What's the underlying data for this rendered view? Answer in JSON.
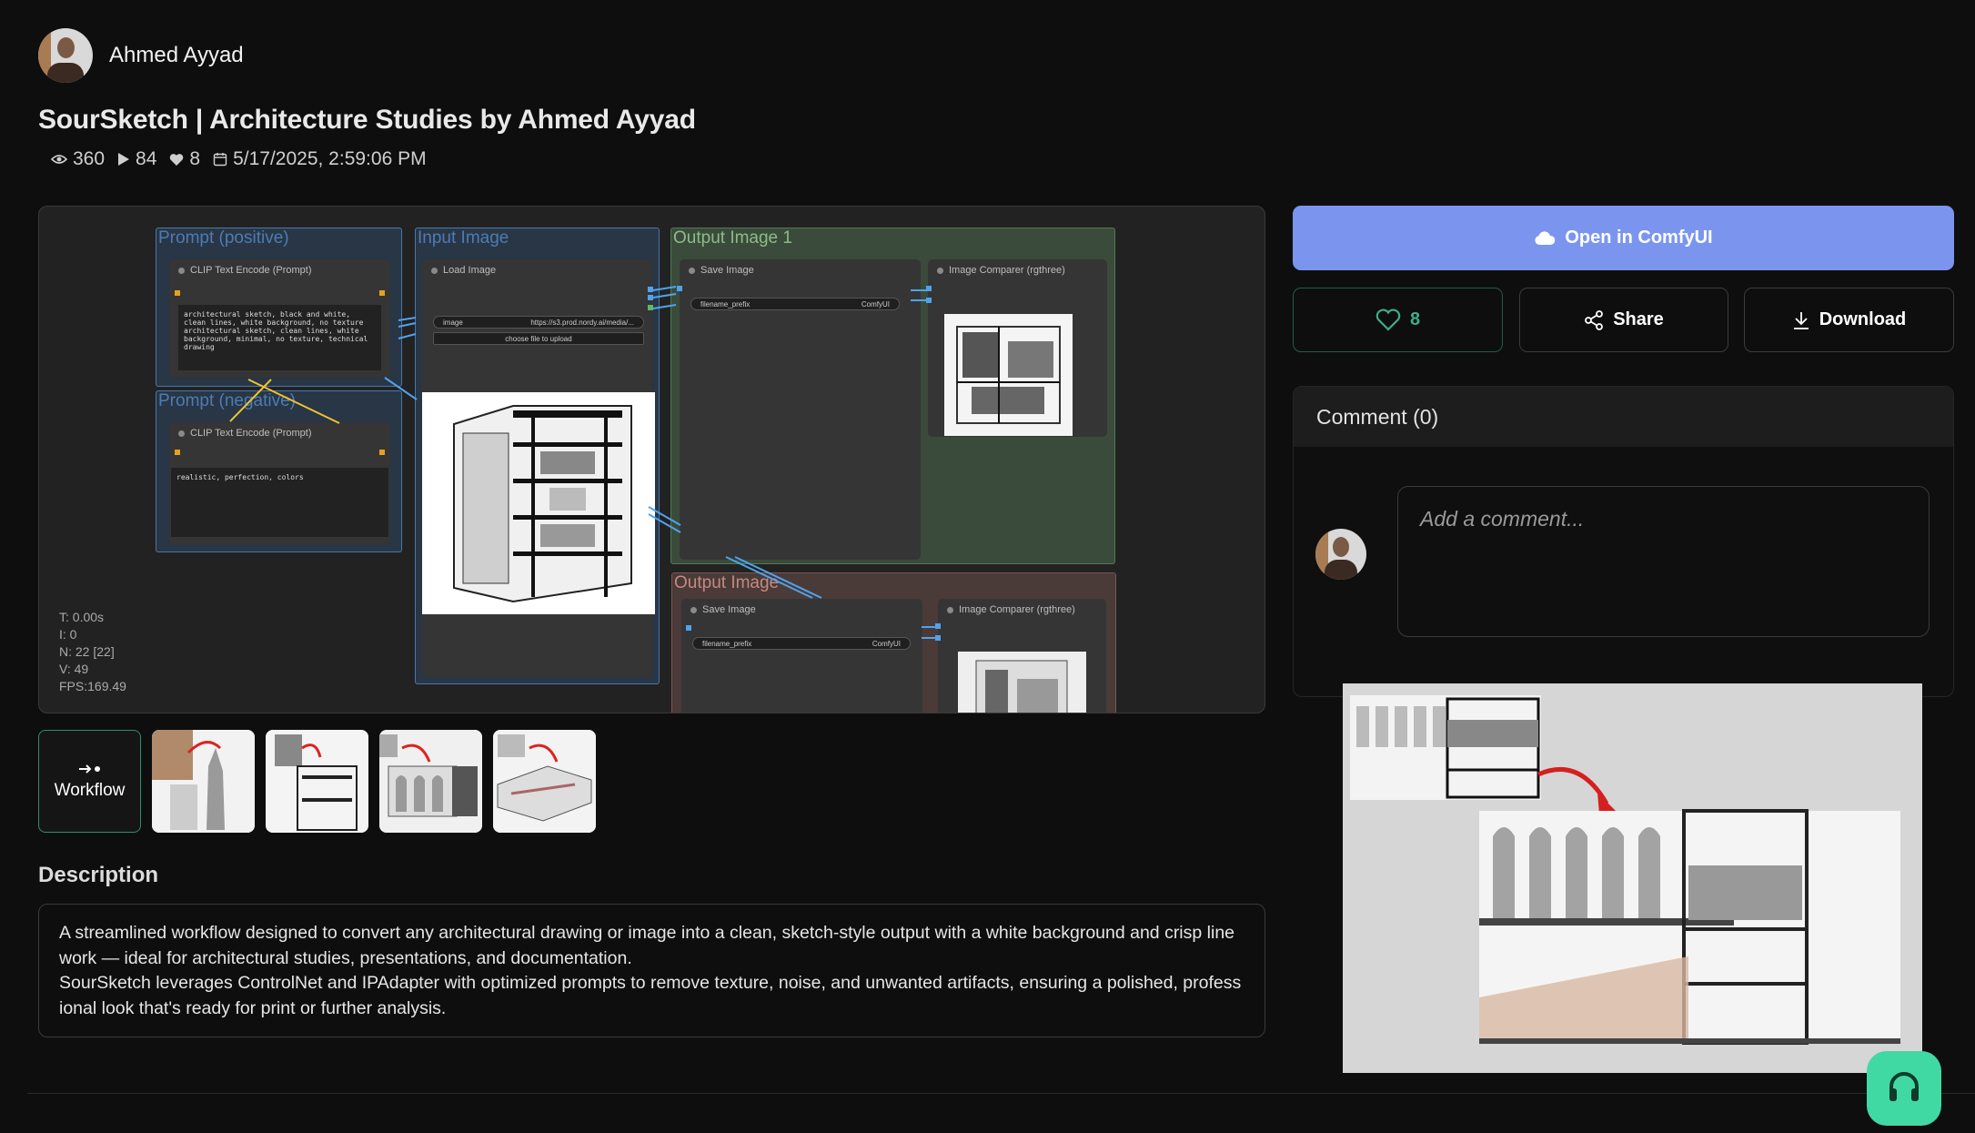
{
  "author": {
    "name": "Ahmed Ayyad"
  },
  "title": "SourSketch | Architecture Studies by Ahmed Ayyad",
  "stats": {
    "views": "360",
    "runs": "84",
    "likes": "8",
    "date": "5/17/2025, 2:59:06 PM"
  },
  "workflow_canvas": {
    "groups": {
      "prompt_positive": "Prompt (positive)",
      "prompt_negative": "Prompt (negative)",
      "input_image": "Input Image",
      "output_image_1": "Output Image  1",
      "output_image_2": "Output Image"
    },
    "nodes": {
      "clip_positive": "CLIP Text Encode (Prompt)",
      "clip_negative": "CLIP Text Encode (Prompt)",
      "load_image": "Load Image",
      "save_image_1": "Save Image",
      "comparer_1": "Image Comparer (rgthree)",
      "save_image_2": "Save Image",
      "comparer_2": "Image Comparer (rgthree)"
    },
    "positive_text": "architectural sketch, black and white, clean lines, white background, no texture\narchitectural sketch, clean lines, white background, minimal, no texture, technical drawing",
    "negative_text": "realistic, perfection, colors",
    "image_widget": {
      "label": "image",
      "value": "https://s3.prod.nordy.ai/media/..."
    },
    "upload_label": "choose file to upload",
    "filename_prefix": {
      "label": "filename_prefix",
      "value": "ComfyUI"
    },
    "debug": [
      "T: 0.00s",
      "I: 0",
      "N: 22 [22]",
      "V: 49",
      "FPS:169.49"
    ]
  },
  "thumbnails": {
    "workflow_label": "Workflow"
  },
  "description": {
    "heading": "Description",
    "line1": "A streamlined workflow designed to convert any architectural drawing or image into a clean, sketch-style output with a white background and crisp line work — ideal for architectural studies, presentations, and documentation.",
    "line2": "SourSketch leverages ControlNet and IPAdapter with optimized prompts to remove texture, noise, and unwanted artifacts, ensuring a polished, profess ional look that's ready for print or further analysis."
  },
  "actions": {
    "open": "Open in ComfyUI",
    "likes": "8",
    "share": "Share",
    "download": "Download"
  },
  "comments": {
    "heading": "Comment (0)",
    "placeholder": "Add a comment..."
  },
  "colors": {
    "accent_blue": "#7b95ef",
    "like_green": "#3fae85",
    "help_green": "#41d9a3",
    "background": "#0e0e0e"
  }
}
